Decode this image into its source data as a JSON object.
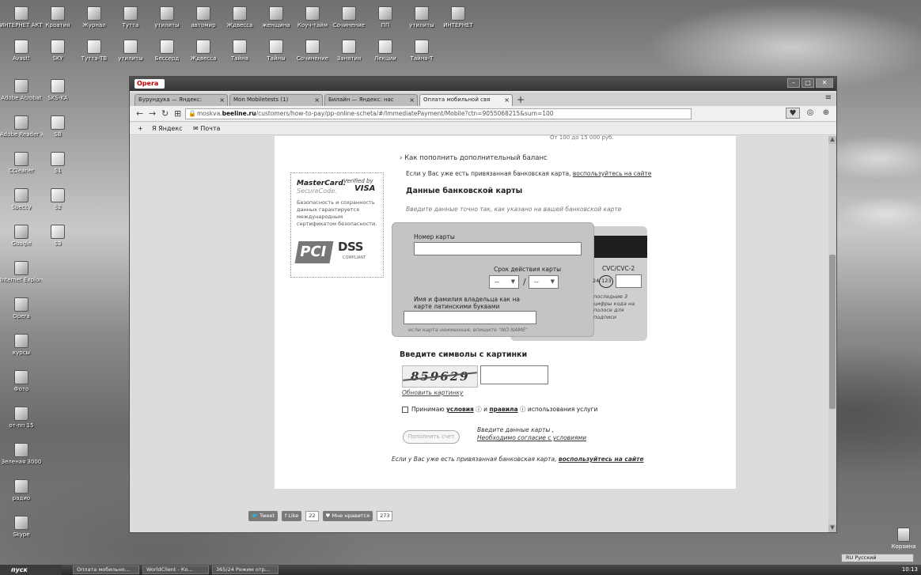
{
  "desktop": {
    "icons_top": [
      {
        "label": "ИНТЕРНЕТ АКТ-ЛКО...",
        "icon": "opera-globe-icon"
      },
      {
        "label": "Кроатия",
        "icon": "folder-icon"
      },
      {
        "label": "Журнал",
        "icon": "folder-icon"
      },
      {
        "label": "Тутта",
        "icon": "folder-icon"
      },
      {
        "label": "утилиты",
        "icon": "folder-icon"
      },
      {
        "label": "автомир",
        "icon": "folder-icon"
      },
      {
        "label": "Ждвесса",
        "icon": "folder-icon"
      },
      {
        "label": "женщина",
        "icon": "folder-icon"
      },
      {
        "label": "Коуч-тайм",
        "icon": "folder-icon"
      },
      {
        "label": "Сочинение",
        "icon": "folder-icon"
      },
      {
        "label": "ПП",
        "icon": "folder-icon"
      },
      {
        "label": "утилиты",
        "icon": "folder-icon"
      },
      {
        "label": "ИНТЕРНЕТ",
        "icon": "folder-icon"
      }
    ],
    "icons_row2": [
      {
        "label": "Avast!",
        "icon": "avast-icon"
      },
      {
        "label": "SKY",
        "icon": "document-icon"
      },
      {
        "label": "Тутта-ТВ",
        "icon": "document-icon"
      },
      {
        "label": "утилиты",
        "icon": "document-icon"
      },
      {
        "label": "Бессерд",
        "icon": "document-icon"
      },
      {
        "label": "Ждвесса",
        "icon": "document-icon"
      },
      {
        "label": "Тайна",
        "icon": "document-icon"
      },
      {
        "label": "Тайны",
        "icon": "document-icon"
      },
      {
        "label": "Сочинение",
        "icon": "document-icon"
      },
      {
        "label": "Занятия",
        "icon": "document-icon"
      },
      {
        "label": "Лекции",
        "icon": "document-icon"
      },
      {
        "label": "Тайна-Т",
        "icon": "document-icon"
      }
    ],
    "icons_left": [
      {
        "label": "Adobe Acrobat",
        "icon": "adobe-icon"
      },
      {
        "label": "Adobe Reader X",
        "icon": "reader-icon"
      },
      {
        "label": "CCleaner",
        "icon": "ccleaner-icon"
      },
      {
        "label": "Speccy",
        "icon": "speccy-icon"
      },
      {
        "label": "Google",
        "icon": "globe-icon"
      },
      {
        "label": "Internet Explorer",
        "icon": "ie-icon"
      },
      {
        "label": "Opera",
        "icon": "opera-icon"
      },
      {
        "label": "курсы",
        "icon": "folder-icon"
      },
      {
        "label": "Фото",
        "icon": "folder-icon"
      },
      {
        "label": "от-пп 15",
        "icon": "folder-icon"
      },
      {
        "label": "Зеленая 3000",
        "icon": "recycle-icon"
      },
      {
        "label": "радио",
        "icon": "folder-icon"
      },
      {
        "label": "Skype",
        "icon": "skype-icon"
      }
    ],
    "icons_left2": [
      {
        "label": "SKS-KA",
        "icon": "folder-icon"
      },
      {
        "label": "SB",
        "icon": "document-icon"
      },
      {
        "label": "S1",
        "icon": "document-icon"
      },
      {
        "label": "S2",
        "icon": "document-icon"
      },
      {
        "label": "S3",
        "icon": "document-icon"
      }
    ],
    "trash_label": "Корзина",
    "lang_label": "RU Русский"
  },
  "browser": {
    "app_name": "Opera",
    "tabs": [
      {
        "label": "Бурундука — Яндекс:",
        "active": false
      },
      {
        "label": "Mon Mobiletests (1)",
        "active": false
      },
      {
        "label": "Билайн — Яндекс: нас",
        "active": false
      },
      {
        "label": "Оплата мобильной свя",
        "active": true
      }
    ],
    "url_prefix": "moskva.",
    "url_domain": "beeline.ru",
    "url_rest": "/customers/how-to-pay/pp-online-scheta/#/ImmediatePayment/Mobile?ctn=9055068215&sum=100",
    "bookmarks": [
      "Яндекс",
      "Почта"
    ]
  },
  "page": {
    "top_snippet": "От 100 до 15 000 руб.",
    "additional_balance_link": "Как пополнить дополнительный баланс",
    "linked_card_note_prefix": "Если у Вас уже есть привязанная банковская карта, ",
    "linked_card_note_link": "воспользуйтесь на сайте",
    "bank_card_heading": "Данные банковской карты",
    "bank_card_hint": "Введите данные точно так, как указано на вашей банковской карте",
    "security": {
      "mastercard": "MasterCard.",
      "securecode": "SecureCode.",
      "verified_by": "Verified by",
      "visa": "VISA",
      "text": "Безопасность и сохранность данных гарантируется международным сертификатом безопасности.",
      "pci": "PCI",
      "dss": "DSS",
      "compliant": "COMPLIANT"
    },
    "card": {
      "number_label": "Номер карты",
      "number_value": "",
      "expiry_label": "Срок действия карты",
      "month_value": "--",
      "year_value": "--",
      "name_label": "Имя и фамилия владельца как на карте латинскими буквами",
      "name_value": "",
      "name_hint": "если карта неименная, впишите \"NO NAME\"",
      "cvc_label": "CVC/CVC-2",
      "cvc_icon_text": "123",
      "cvc_prefix": "24",
      "cvc_value": "",
      "cvc_hint": "последние 3 цифры кода на полосе для подписи"
    },
    "captcha": {
      "heading": "Введите символы с картинки",
      "image_text": "859629",
      "refresh_label": "Обновить картинку",
      "value": ""
    },
    "agree": {
      "prefix": "Принимаю ",
      "terms": "условия",
      "mid": " и ",
      "rules": "правила",
      "suffix": " использования услуги"
    },
    "pay_button": "Пополнить счет",
    "pay_note_1": "Введите данные карты ,",
    "pay_note_2": "Необходимо согласие с условиями",
    "bottom_note_prefix": "Если у Вас уже есть привязанная банковская карта, ",
    "bottom_note_link": "воспользуйтесь на сайте",
    "social": {
      "tweet": "Tweet",
      "like": "Like",
      "like_count": "22",
      "vk": "Мне нравится",
      "vk_count": "273"
    }
  },
  "taskbar": {
    "start": "пуск",
    "tasks": [
      "Оплата мобильно...",
      "WorldClient - Ко...",
      "365/24 Режим отр..."
    ],
    "clock": "10:13"
  }
}
